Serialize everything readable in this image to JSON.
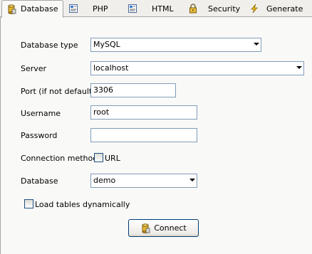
{
  "tabs": [
    {
      "label": "Database",
      "icon": "database-icon",
      "active": true
    },
    {
      "label": "PHP",
      "icon": "php-file-icon"
    },
    {
      "label": "HTML",
      "icon": "html-file-icon"
    },
    {
      "label": "Security",
      "icon": "padlock-icon"
    },
    {
      "label": "Generate",
      "icon": "lightning-icon"
    }
  ],
  "form": {
    "db_type": {
      "label": "Database type",
      "value": "MySQL"
    },
    "server": {
      "label": "Server",
      "value": "localhost"
    },
    "port": {
      "label": "Port (if not default)",
      "value": "3306"
    },
    "username": {
      "label": "Username",
      "value": "root"
    },
    "password": {
      "label": "Password",
      "value": ""
    },
    "connection_method": {
      "label": "Connection method",
      "option_label": "URL",
      "checked": false
    },
    "database": {
      "label": "Database",
      "value": "demo"
    },
    "load_tables": {
      "label": "Load tables dynamically",
      "checked": false
    }
  },
  "connect_button": {
    "label": "Connect",
    "icon": "database-icon"
  },
  "colors": {
    "field_border": "#7f9db9",
    "panel_bg": "#f9f9f8",
    "window_bg": "#f0efeb",
    "button_border": "#003c74"
  }
}
